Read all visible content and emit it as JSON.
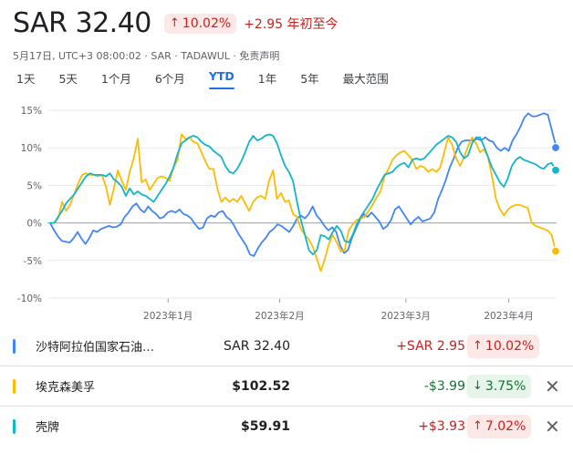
{
  "header": {
    "currency": "SAR",
    "price": "SAR 32.40",
    "pct_change": "10.02%",
    "abs_change": "+2.95 年初至今"
  },
  "meta_text": "5月17日, UTC+3 08:00:02 · SAR · TADAWUL · 免责声明",
  "tabs": [
    {
      "label": "1天",
      "active": false
    },
    {
      "label": "5天",
      "active": false
    },
    {
      "label": "1个月",
      "active": false
    },
    {
      "label": "6个月",
      "active": false
    },
    {
      "label": "YTD",
      "active": true
    },
    {
      "label": "1年",
      "active": false
    },
    {
      "label": "5年",
      "active": false
    },
    {
      "label": "最大范围",
      "active": false
    }
  ],
  "chart_data": {
    "type": "line",
    "y_ticks": [
      "15%",
      "10%",
      "5%",
      "0%",
      "-5%",
      "-10%"
    ],
    "y_tick_values": [
      15,
      10,
      5,
      0,
      -5,
      -10
    ],
    "ylim": [
      -10,
      15
    ],
    "x_ticks": [
      "2023年1月",
      "2023年2月",
      "2023年3月",
      "2023年4月"
    ],
    "x_tick_positions": [
      0.237,
      0.456,
      0.704,
      0.906
    ],
    "grid": true,
    "series": [
      {
        "name": "沙特阿拉伯国家石油…",
        "color": "#4285f4",
        "values": [
          0,
          -1,
          -1.8,
          -2.4,
          -2.5,
          -2.6,
          -2,
          -1.2,
          -2.1,
          -2.8,
          -2,
          -1,
          -1.2,
          -0.8,
          -0.6,
          -0.4,
          -0.6,
          -0.5,
          -0.2,
          0.8,
          1.4,
          2.2,
          2.6,
          1.8,
          1.4,
          2.2,
          1.6,
          1.2,
          0.6,
          0.8,
          1.4,
          1.6,
          1.4,
          1.8,
          1.2,
          1,
          0.6,
          -0.2,
          -0.8,
          -0.6,
          0.6,
          1,
          0.8,
          1.4,
          1.6,
          0.8,
          0.4,
          -0.4,
          -1.4,
          -2.2,
          -3,
          -4.2,
          -4.4,
          -3.4,
          -2.6,
          -2,
          -1.2,
          -0.8,
          -0.2,
          -0.4,
          -0.8,
          -1.2,
          -0.4,
          0.6,
          1,
          0.6,
          1.2,
          2.2,
          1,
          0.4,
          -0.4,
          -1,
          -0.6,
          -1.2,
          -3,
          -4,
          -3.6,
          -2,
          -0.8,
          0.4,
          1.2,
          0.8,
          1.4,
          0.8,
          0.2,
          -0.8,
          -0.4,
          0.4,
          1.8,
          2.2,
          1.4,
          0.6,
          -0.2,
          0.4,
          0.8,
          0.2,
          0.4,
          0.6,
          1.4,
          3.2,
          4.4,
          5.8,
          7.4,
          8.6,
          10,
          10.8,
          11,
          11,
          11,
          11.2,
          11,
          11.4,
          11,
          10.8,
          10,
          9.6,
          10,
          9.6,
          11,
          11.8,
          12.8,
          14,
          14.6,
          14.2,
          14.2,
          14.4,
          14.6,
          14.4,
          12.4,
          10.4
        ],
        "end_value": 10.02
      },
      {
        "name": "埃克森美孚",
        "color": "#fbbc04",
        "values": [
          0,
          0,
          0.6,
          2.8,
          1.6,
          2.4,
          3.8,
          5.2,
          6.4,
          6.6,
          6.4,
          6.4,
          6.2,
          6.4,
          4.8,
          2.4,
          4.6,
          7,
          5.6,
          4.4,
          6.8,
          8.6,
          11.2,
          5.4,
          5.8,
          4.4,
          5.2,
          6,
          6.2,
          6,
          5.6,
          7.4,
          8.4,
          11.8,
          11.2,
          11.4,
          10.8,
          10.6,
          9.4,
          8.2,
          7.2,
          7.2,
          4.6,
          2.8,
          3.4,
          2.8,
          3.2,
          2.8,
          3.6,
          2.6,
          1.6,
          2.8,
          3.4,
          3.6,
          3.2,
          5.6,
          7,
          3.2,
          4,
          2.8,
          3,
          1.2,
          0.8,
          -0.8,
          -1.6,
          -2.2,
          -3.2,
          -4.8,
          -6.4,
          -4.8,
          -2.8,
          -1.6,
          -2.6,
          -3.8,
          -3.6,
          -1,
          -0.2,
          0.4,
          0.6,
          0.8,
          1.6,
          2.4,
          3.4,
          4.2,
          6.2,
          7.2,
          8.4,
          9,
          9.4,
          9.6,
          9,
          8.4,
          7.2,
          7.6,
          7.4,
          6.8,
          7.2,
          6.8,
          7.4,
          9.4,
          11.4,
          10.4,
          8.6,
          7.6,
          8.8,
          10.2,
          11.4,
          10.6,
          9.4,
          9.8,
          8.8,
          6.2,
          3.2,
          1.8,
          1,
          1.8,
          2.2,
          2.4,
          2.4,
          2.2,
          2,
          0,
          -0.4,
          -0.6,
          -0.8,
          -1,
          -1.6,
          -3.75
        ],
        "end_value": -3.75
      },
      {
        "name": "壳牌",
        "color": "#12b5cb",
        "values": [
          0,
          0,
          0.8,
          1.6,
          2.6,
          3.2,
          3.8,
          4.6,
          5.4,
          6.2,
          6.6,
          6.4,
          6.4,
          6.4,
          6.2,
          6.6,
          5.8,
          5.4,
          4.8,
          3.6,
          4.6,
          3.8,
          4.2,
          3.8,
          3.6,
          3.2,
          2.8,
          3.6,
          4.4,
          5.2,
          6.2,
          7.4,
          9.2,
          10.6,
          11,
          11.4,
          11.6,
          11.4,
          10.8,
          10.4,
          10.2,
          9.6,
          9.2,
          8.8,
          7.6,
          6.8,
          6.6,
          7.2,
          8.2,
          9.4,
          10.8,
          11.6,
          11,
          11.2,
          11.6,
          11.8,
          11.6,
          10.6,
          9,
          7.6,
          6.8,
          5.6,
          2.8,
          0.4,
          -1.6,
          -3.6,
          -4.2,
          -3.6,
          -1.6,
          -1.8,
          -2.2,
          -1.2,
          -0.4,
          -1,
          -2.4,
          -2.6,
          -1.6,
          -0.2,
          0.8,
          1.6,
          2.4,
          3.2,
          4.4,
          5.4,
          6.4,
          6.6,
          6.8,
          7.4,
          7.8,
          8,
          7.4,
          8.4,
          8.6,
          8.4,
          8.6,
          9.2,
          9.8,
          10.4,
          10.8,
          11.2,
          11.6,
          11.4,
          10.8,
          9.4,
          8.6,
          9,
          10.6,
          11.4,
          11.4,
          10.2,
          8.8,
          7.4,
          6.4,
          5.4,
          4.8,
          6,
          7.6,
          8.4,
          8.8,
          8.4,
          8.2,
          8,
          7.8,
          7.4,
          7.2,
          7.8,
          8,
          7.02
        ],
        "end_value": 7.02
      }
    ]
  },
  "rows": [
    {
      "name": "沙特阿拉伯国家石油…",
      "price": "SAR 32.40",
      "change": "+SAR 2.95",
      "pct": "10.02%",
      "dir": "up",
      "color": "#4285f4",
      "removable": false
    },
    {
      "name": "埃克森美孚",
      "price": "$102.52",
      "change": "-$3.99",
      "pct": "3.75%",
      "dir": "down",
      "color": "#fbbc04",
      "removable": true
    },
    {
      "name": "壳牌",
      "price": "$59.91",
      "change": "+$3.93",
      "pct": "7.02%",
      "dir": "up",
      "color": "#12b5cb",
      "removable": true
    }
  ],
  "colors": {
    "up": "#c5221f",
    "down": "#137333",
    "accent": "#1a73e8",
    "grid": "#e8eaed",
    "zero_line": "#9aa0a6"
  },
  "icons": {
    "up": "arrow-up-icon",
    "down": "arrow-down-icon",
    "close": "close-icon"
  }
}
